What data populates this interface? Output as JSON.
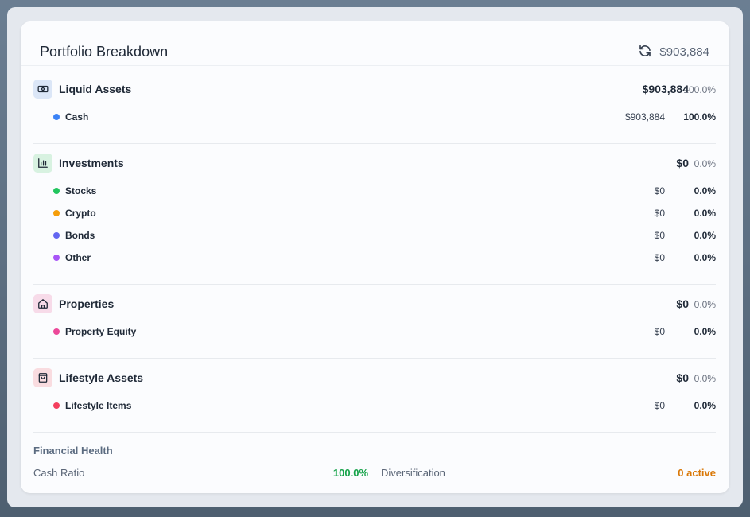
{
  "header": {
    "title": "Portfolio Breakdown",
    "total": "$903,884"
  },
  "sections": [
    {
      "title": "Liquid Assets",
      "amount": "$903,884",
      "pct": "100.0%",
      "icon": "cash-icon",
      "icon_bg": "#dbe6f7",
      "items": [
        {
          "label": "Cash",
          "amount": "$903,884",
          "pct": "100.0%",
          "color": "#3b82f6"
        }
      ]
    },
    {
      "title": "Investments",
      "amount": "$0",
      "pct": "0.0%",
      "icon": "bar-chart-icon",
      "icon_bg": "#d8f2e1",
      "items": [
        {
          "label": "Stocks",
          "amount": "$0",
          "pct": "0.0%",
          "color": "#22c55e"
        },
        {
          "label": "Crypto",
          "amount": "$0",
          "pct": "0.0%",
          "color": "#f59e0b"
        },
        {
          "label": "Bonds",
          "amount": "$0",
          "pct": "0.0%",
          "color": "#6366f1"
        },
        {
          "label": "Other",
          "amount": "$0",
          "pct": "0.0%",
          "color": "#a855f7"
        }
      ]
    },
    {
      "title": "Properties",
      "amount": "$0",
      "pct": "0.0%",
      "icon": "home-icon",
      "icon_bg": "#f7dbe9",
      "items": [
        {
          "label": "Property Equity",
          "amount": "$0",
          "pct": "0.0%",
          "color": "#ec4899"
        }
      ]
    },
    {
      "title": "Lifestyle Assets",
      "amount": "$0",
      "pct": "0.0%",
      "icon": "shopping-bag-icon",
      "icon_bg": "#f9dce0",
      "items": [
        {
          "label": "Lifestyle Items",
          "amount": "$0",
          "pct": "0.0%",
          "color": "#f43f5e"
        }
      ]
    }
  ],
  "health": {
    "title": "Financial Health",
    "cash_ratio_label": "Cash Ratio",
    "cash_ratio_value": "100.0%",
    "cash_ratio_color": "#16a34a",
    "diversification_label": "Diversification",
    "diversification_value": "0 active",
    "diversification_color": "#d97706"
  }
}
